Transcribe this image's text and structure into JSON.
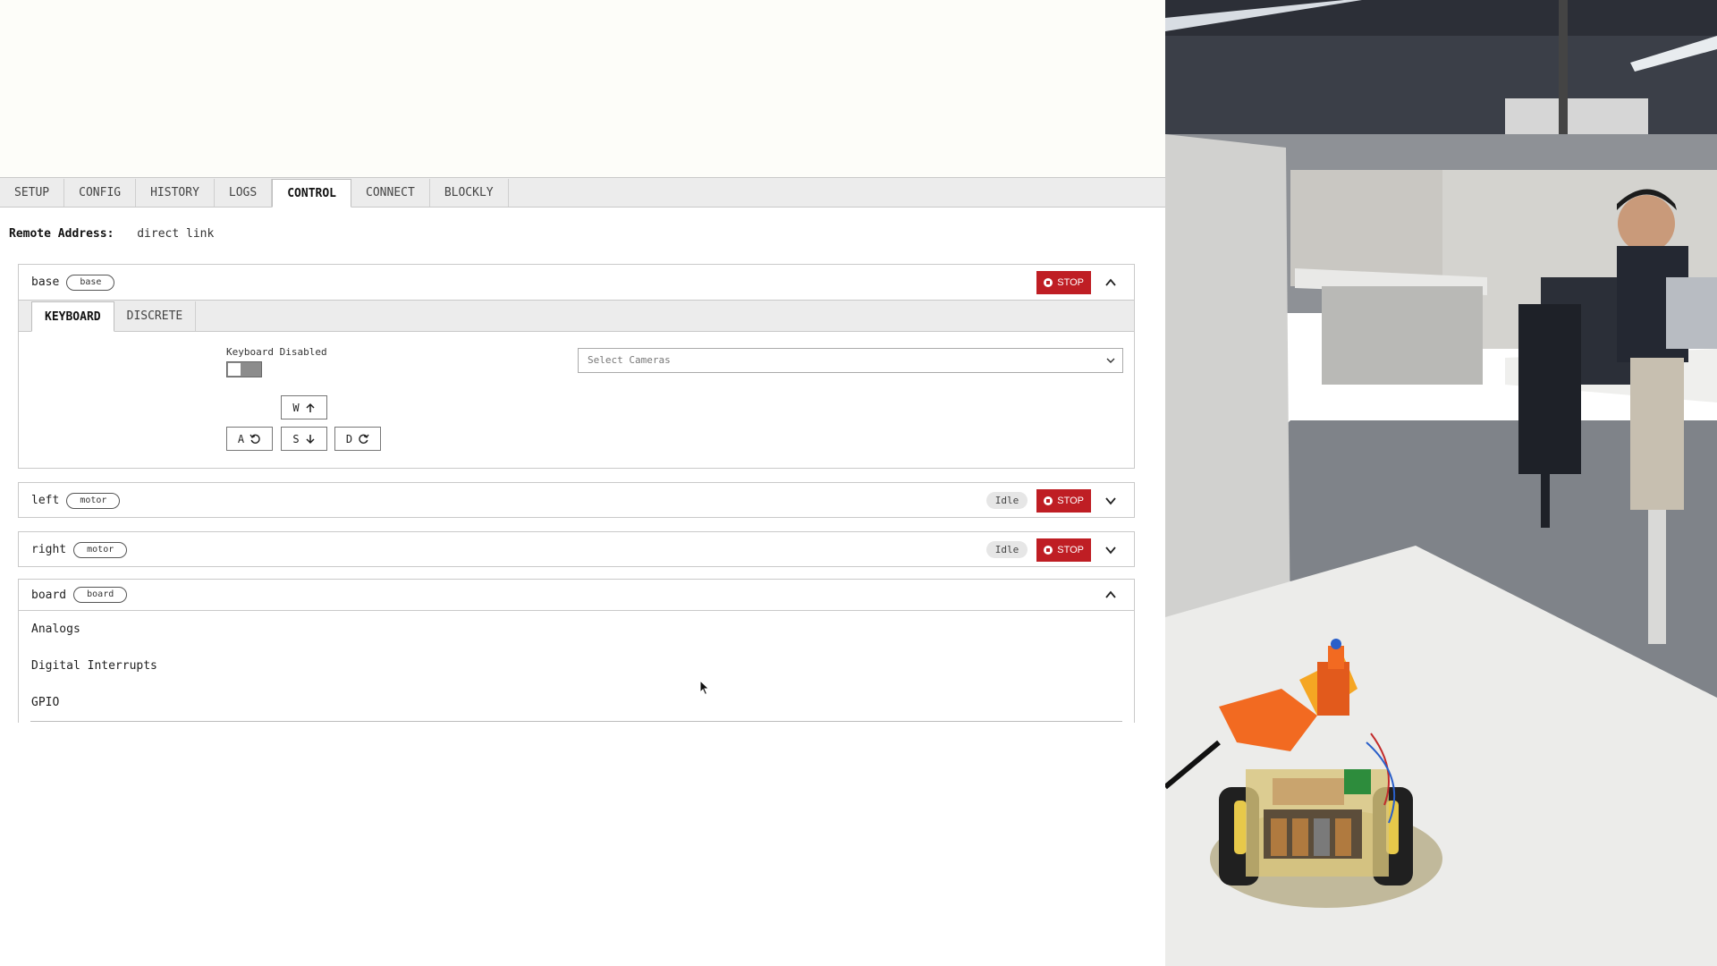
{
  "tabs": [
    "SETUP",
    "CONFIG",
    "HISTORY",
    "LOGS",
    "CONTROL",
    "CONNECT",
    "BLOCKLY"
  ],
  "active_tab": "CONTROL",
  "remote": {
    "label": "Remote Address:",
    "value": "direct link"
  },
  "base": {
    "name": "base",
    "type": "base",
    "stop_label": "STOP",
    "subtabs": [
      "KEYBOARD",
      "DISCRETE"
    ],
    "keyboard_label": "Keyboard Disabled",
    "keys": {
      "w": "W",
      "a": "A",
      "s": "S",
      "d": "D"
    },
    "camera_placeholder": "Select Cameras"
  },
  "left": {
    "name": "left",
    "type": "motor",
    "status": "Idle",
    "stop_label": "STOP"
  },
  "right": {
    "name": "right",
    "type": "motor",
    "status": "Idle",
    "stop_label": "STOP"
  },
  "board": {
    "name": "board",
    "type": "board",
    "sections": [
      "Analogs",
      "Digital Interrupts",
      "GPIO"
    ]
  },
  "colors": {
    "stop": "#bf1e24",
    "tab_bg": "#ececec"
  }
}
